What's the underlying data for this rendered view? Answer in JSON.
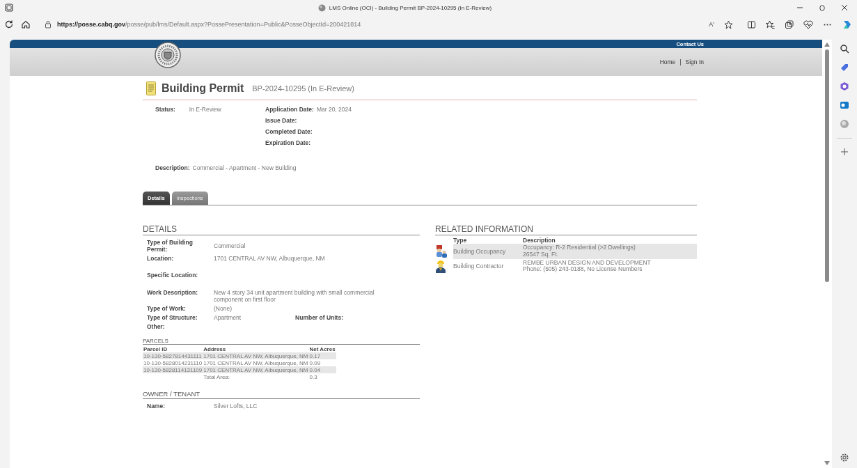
{
  "browser": {
    "tab_title": "LMS Online (OCI) - Building Permit BP-2024-10295 (In E-Review)",
    "url_host": "https://posse.cabq.gov",
    "url_path": "/posse/pub/lms/Default.aspx?PossePresentation=Public&PosseObjectId=200421814",
    "read_aloud": "Aʹ"
  },
  "header": {
    "contact": "Contact Us",
    "nav": [
      "Home",
      "Sign In"
    ],
    "separator": "|"
  },
  "permit": {
    "title": "Building Permit",
    "number": "BP-2024-10295 (In E-Review)",
    "status": {
      "label": "Status:",
      "value": "In E-Review"
    },
    "dates": [
      {
        "label": "Application Date:",
        "value": "Mar 20, 2024"
      },
      {
        "label": "Issue Date:"
      },
      {
        "label": "Completed Date:"
      },
      {
        "label": "Expiration Date:"
      }
    ],
    "description": {
      "label": "Description:",
      "value": "Commercial - Apartment - New Building"
    }
  },
  "tabs": [
    {
      "label": "Details",
      "selected": true
    },
    {
      "label": "Inspections",
      "selected": false
    }
  ],
  "details": {
    "title": "DETAILS",
    "fields": [
      {
        "label": "Type of Building Permit:",
        "value": "Commercial"
      },
      {
        "label": "Location:",
        "value": "1701 CENTRAL AV NW, Albuquerque, NM"
      },
      {
        "label": "Specific Location:"
      },
      {
        "label": "Work Description:",
        "value": "New 4 story 34 unit apartment building with small commercial component on first floor"
      },
      {
        "label": "Type of Work:",
        "value": "(None)"
      },
      {
        "label": "Type of Structure:",
        "value": "Apartment",
        "extra_label": "Number of Units:"
      },
      {
        "label": "Other:"
      }
    ]
  },
  "parcels": {
    "title": "PARCELS",
    "columns": [
      "Parcel ID",
      "Address",
      "Net Acres"
    ],
    "rows": [
      {
        "cells": [
          "10-130-5827814431111",
          "1701 CENTRAL AV NW, Albuquerque, NM",
          "0.17"
        ],
        "shaded": true
      },
      {
        "cells": [
          "10-130-5828014231110",
          "1701 CENTRAL AV NW, Albuquerque, NM",
          "0.09"
        ],
        "shaded": false
      },
      {
        "cells": [
          "10-130-5828114131109",
          "1701 CENTRAL AV NW, Albuquerque, NM",
          "0.04"
        ],
        "shaded": true
      }
    ],
    "total_label": "Total Area:",
    "total": "0.3"
  },
  "owner": {
    "title": "OWNER / TENANT",
    "fields": [
      {
        "label": "Name:",
        "value": "Silver Lofts, LLC"
      }
    ]
  },
  "related": {
    "title": "RELATED INFORMATION",
    "columns": [
      "Type",
      "Description"
    ],
    "rows": [
      {
        "kind": "occupancy",
        "type": "Building Occupancy",
        "description": [
          "Occupancy: R-2 Residential (>2 Dwellings)",
          "26547 Sq. Ft."
        ],
        "shaded": true
      },
      {
        "kind": "contractor",
        "type": "Building Contractor",
        "description": [
          "REMBE URBAN DESIGN AND DEVELOPMENT",
          "Phone: (505) 243-0188, No License Numbers"
        ],
        "shaded": false
      }
    ]
  }
}
